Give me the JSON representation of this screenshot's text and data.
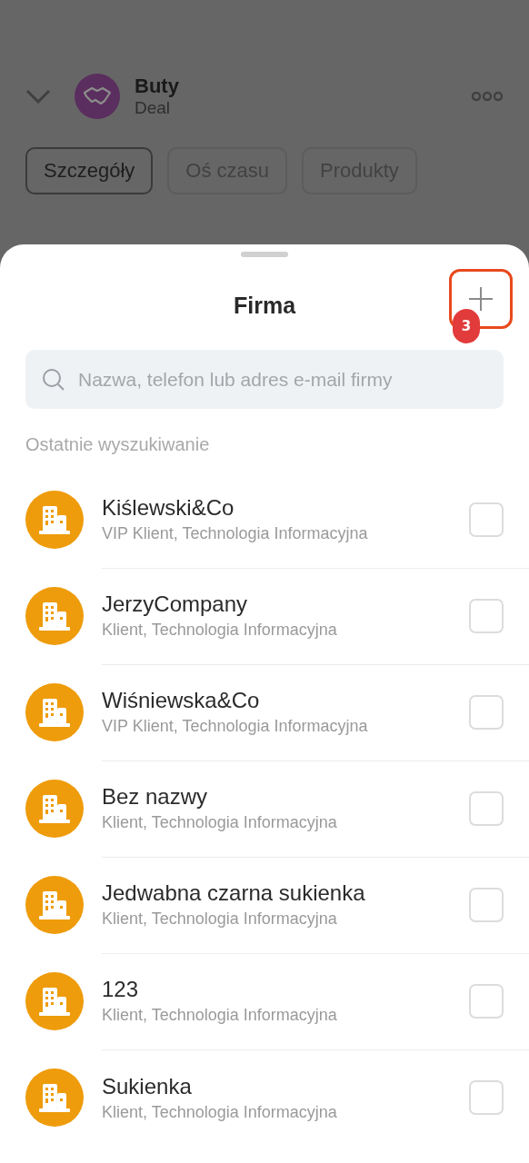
{
  "deal": {
    "title": "Buty",
    "subtitle": "Deal"
  },
  "tabs": [
    {
      "label": "Szczegóły",
      "selected": true
    },
    {
      "label": "Oś czasu",
      "selected": false
    },
    {
      "label": "Produkty",
      "selected": false
    }
  ],
  "sheet": {
    "title": "Firma",
    "annotation_badge": "3",
    "search": {
      "placeholder": "Nazwa, telefon lub adres e-mail firmy"
    },
    "section_label": "Ostatnie wyszukiwanie",
    "companies": [
      {
        "name": "Kiślewski&Co",
        "subtitle": "VIP Klient, Technologia Informacyjna",
        "checked": false
      },
      {
        "name": "JerzyCompany",
        "subtitle": "Klient, Technologia Informacyjna",
        "checked": false
      },
      {
        "name": "Wiśniewska&Co",
        "subtitle": "VIP Klient, Technologia Informacyjna",
        "checked": false
      },
      {
        "name": "Bez nazwy",
        "subtitle": "Klient, Technologia Informacyjna",
        "checked": false
      },
      {
        "name": "Jedwabna czarna sukienka",
        "subtitle": "Klient, Technologia Informacyjna",
        "checked": false
      },
      {
        "name": "123",
        "subtitle": "Klient, Technologia Informacyjna",
        "checked": false
      },
      {
        "name": "Sukienka",
        "subtitle": "Klient, Technologia Informacyjna",
        "checked": false
      }
    ]
  }
}
